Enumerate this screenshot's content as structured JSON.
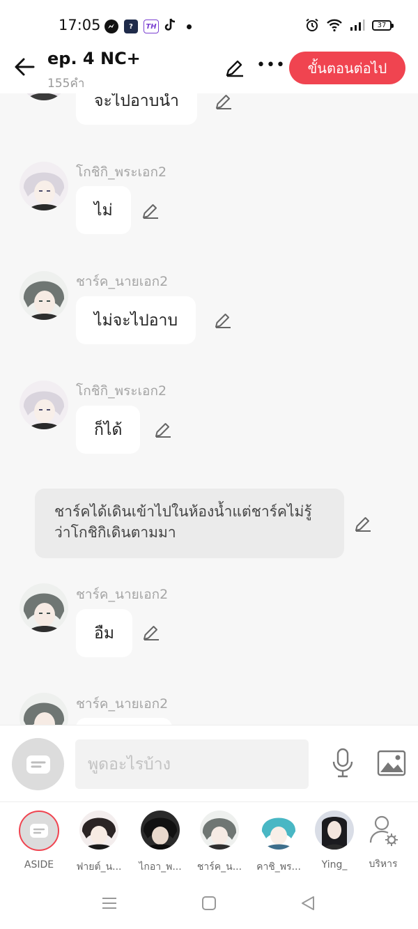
{
  "status": {
    "time": "17:05",
    "battery": "37",
    "app_icons": [
      "messenger-icon",
      "app-2-icon",
      "th-icon",
      "tiktok-icon"
    ]
  },
  "header": {
    "title": "ep. 4 NC+",
    "word_count": "155คำ",
    "next_label": "ขั้นตอนต่อไป",
    "more_label": "•••"
  },
  "messages": [
    {
      "text": "จะไปอาบน้ำ"
    },
    {
      "name": "โกชิกิ_พระเอก2",
      "text": "ไม่"
    },
    {
      "name": "ชาร์ค_นายเอก2",
      "text": "ไม่จะไปอาบ"
    },
    {
      "name": "โกชิกิ_พระเอก2",
      "text": "ก็ได้"
    },
    {
      "name": "ชาร์ค_นายเอก2",
      "text": "อืม"
    },
    {
      "name": "ชาร์ค_นายเอก2",
      "text": ""
    }
  ],
  "narration": {
    "text": "ชาร์คได้เดินเข้าไปในห้องน้ำแต่ชาร์คไม่รู้ว่าโกชิกิเดินตามมา"
  },
  "input": {
    "placeholder": "พูดอะไรบ้าง"
  },
  "characters": [
    {
      "label": "ASIDE"
    },
    {
      "label": "ฟายต์_น..."
    },
    {
      "label": "ไกอา_พ..."
    },
    {
      "label": "ชาร์ค_น..."
    },
    {
      "label": "คาชิ_พร..."
    },
    {
      "label": "Ying_"
    },
    {
      "label": "บริหาร"
    }
  ],
  "colors": {
    "accent": "#f04450",
    "chat_bg": "#f7f7f7",
    "name_gray": "#a5a5a5"
  }
}
